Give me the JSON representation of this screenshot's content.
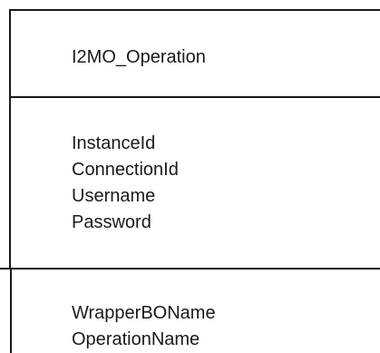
{
  "class_diagram": {
    "class_name": "I2MO_Operation",
    "attributes": [
      "InstanceId",
      "ConnectionId",
      "Username",
      "Password"
    ],
    "operations": [
      "WrapperBOName",
      "OperationName"
    ]
  },
  "colors": {
    "line": "#1a1a1a",
    "text": "#1a1a1a",
    "background": "#ffffff"
  }
}
